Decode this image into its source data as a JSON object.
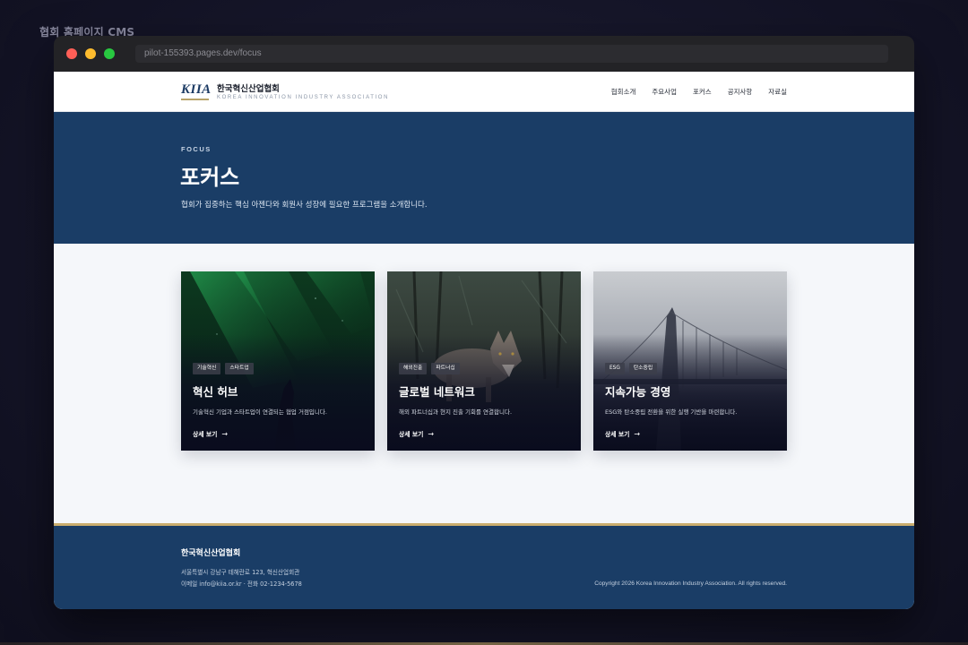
{
  "app": {
    "title": "협회 홈페이지 CMS"
  },
  "browser": {
    "url": "pilot-155393.pages.dev/focus"
  },
  "header": {
    "logo_mark": "KIIA",
    "org_name": "한국혁신산업협회",
    "org_name_en": "KOREA INNOVATION INDUSTRY ASSOCIATION",
    "nav": [
      {
        "label": "협회소개"
      },
      {
        "label": "주요사업"
      },
      {
        "label": "포커스"
      },
      {
        "label": "공지사항"
      },
      {
        "label": "자료실"
      }
    ]
  },
  "hero": {
    "eyebrow": "FOCUS",
    "title": "포커스",
    "description": "협회가 집중하는 핵심 아젠다와 회원사 성장에 필요한 프로그램을 소개합니다."
  },
  "cards": [
    {
      "tags": [
        "기술혁신",
        "스타트업"
      ],
      "title": "혁신 허브",
      "description": "기술혁신 기업과 스타트업이 연결되는 협업 거점입니다.",
      "link": "상세 보기",
      "image": "aurora-night-forest"
    },
    {
      "tags": [
        "해외진출",
        "파트너십"
      ],
      "title": "글로벌 네트워크",
      "description": "해외 파트너십과 현지 진출 기회를 연결합니다.",
      "link": "상세 보기",
      "image": "coyote-in-forest"
    },
    {
      "tags": [
        "ESG",
        "탄소중립"
      ],
      "title": "지속가능 경영",
      "description": "ESG와 탄소중립 전환을 위한 실행 기반을 마련합니다.",
      "link": "상세 보기",
      "image": "foggy-bridge"
    }
  ],
  "footer": {
    "org_name": "한국혁신산업협회",
    "address": "서울특별시 강남구 테헤란로 123, 혁신산업회관",
    "contact": "이메일 info@kiia.or.kr · 전화 02-1234-5678",
    "copyright": "Copyright 2026 Korea Innovation Industry Association. All rights reserved."
  },
  "colors": {
    "brand_navy": "#1a3d66",
    "accent_gold": "#c9ad6e",
    "page_bg": "#f5f7fa"
  }
}
